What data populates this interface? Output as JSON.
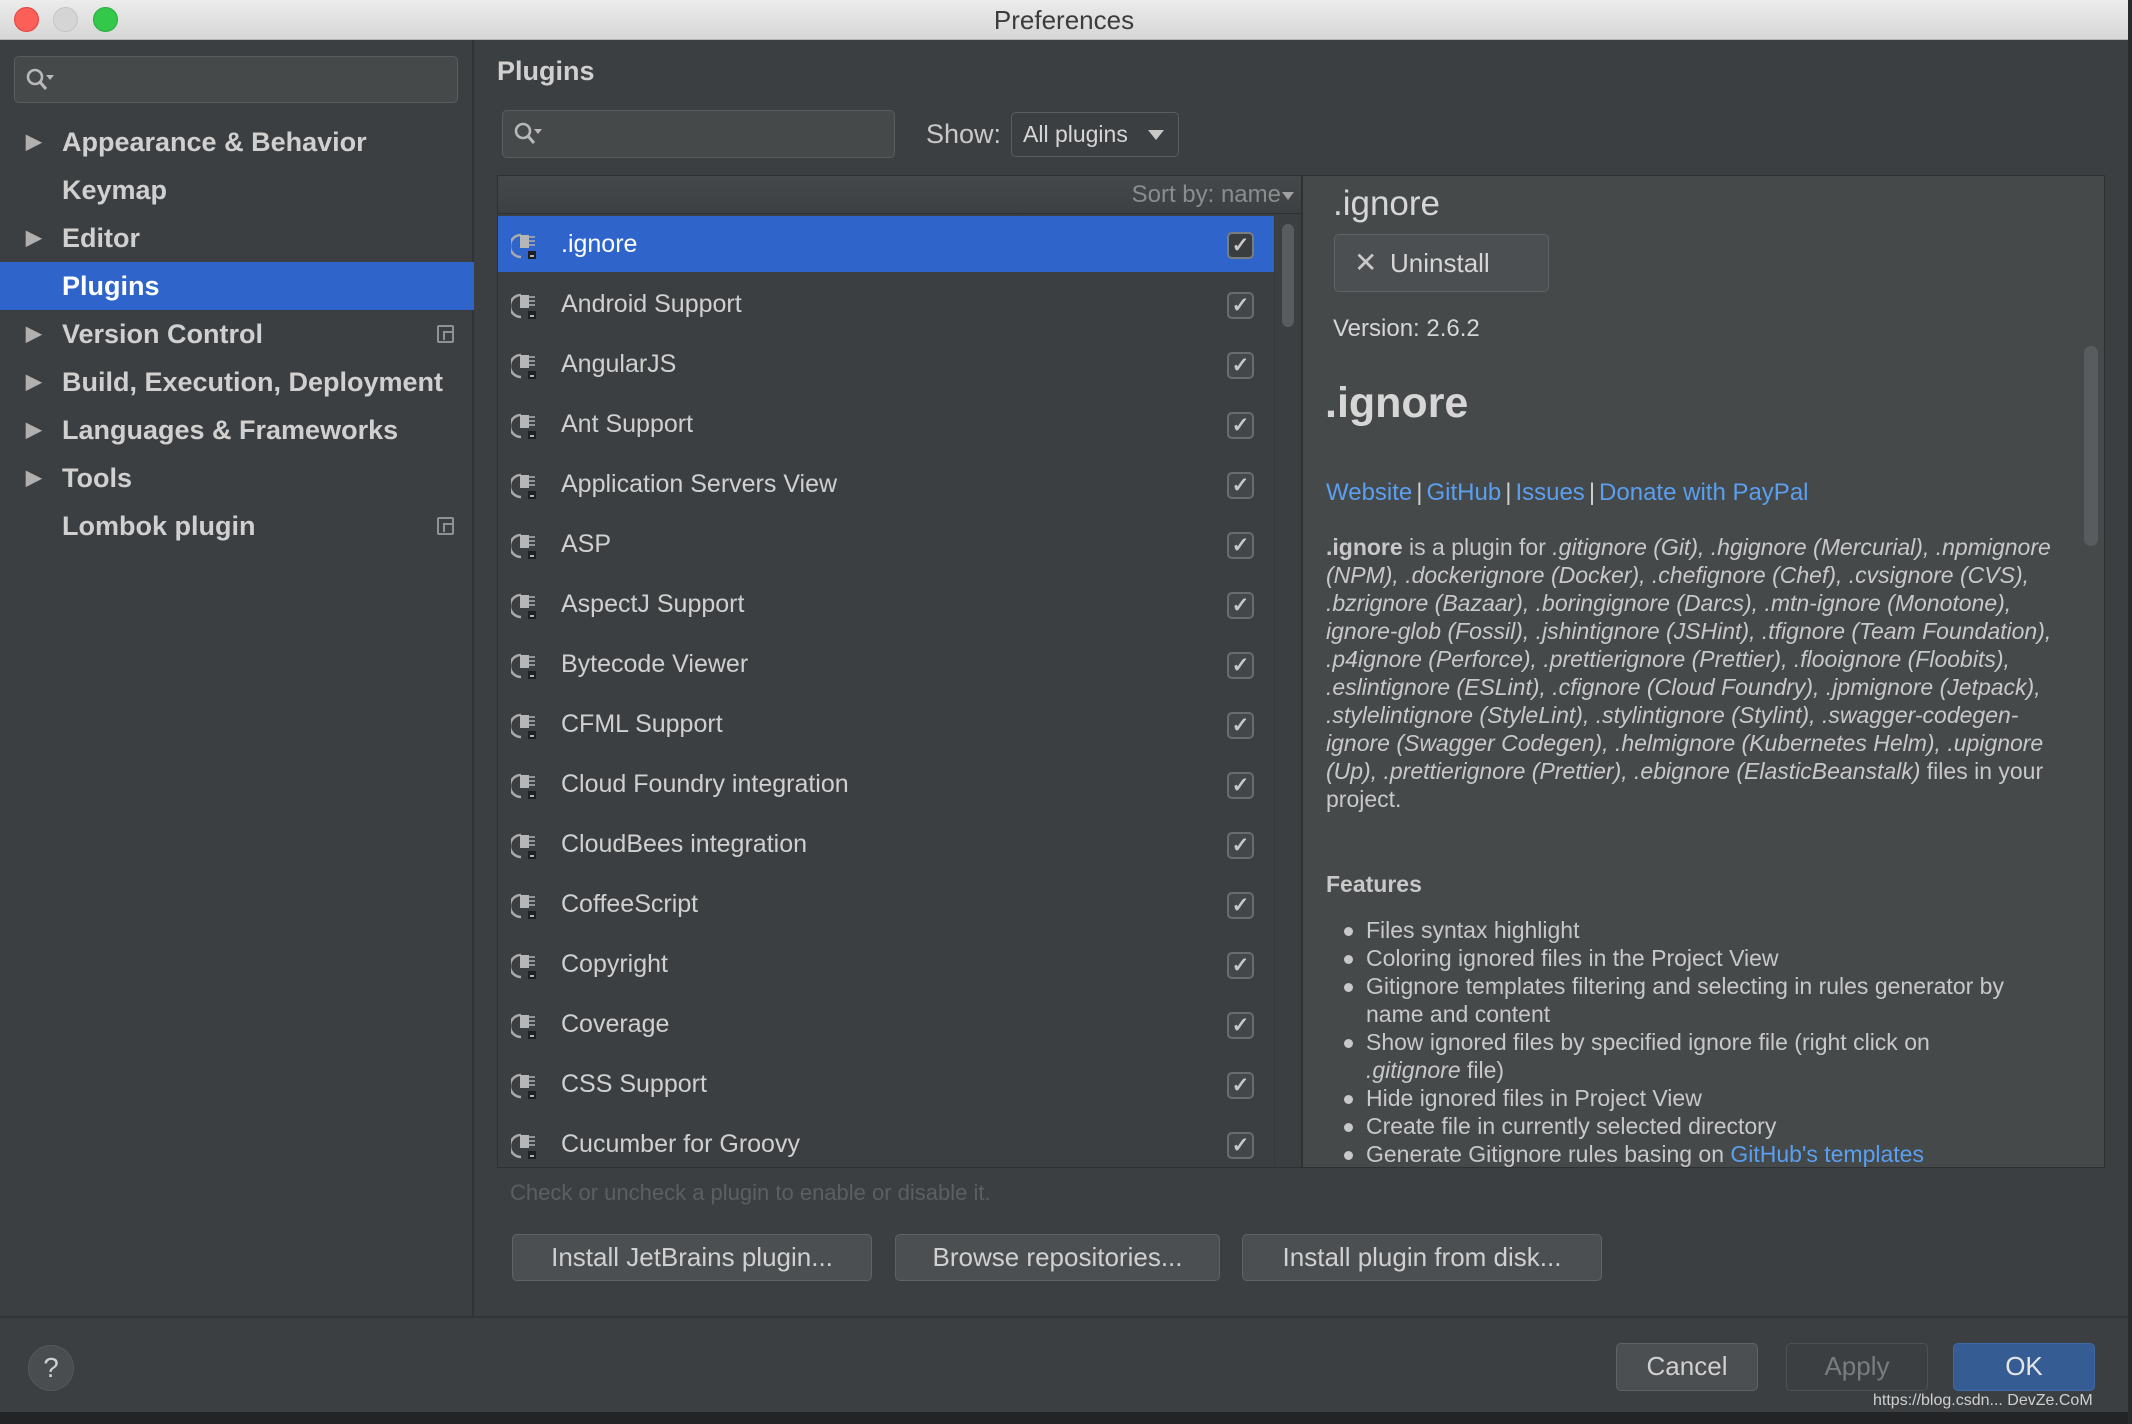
{
  "window": {
    "title": "Preferences"
  },
  "sidebar": {
    "search_placeholder": "",
    "items": [
      {
        "label": "Appearance & Behavior",
        "expandable": true,
        "selected": false,
        "project_icon": false
      },
      {
        "label": "Keymap",
        "expandable": false,
        "selected": false,
        "project_icon": false
      },
      {
        "label": "Editor",
        "expandable": true,
        "selected": false,
        "project_icon": false
      },
      {
        "label": "Plugins",
        "expandable": false,
        "selected": true,
        "project_icon": false
      },
      {
        "label": "Version Control",
        "expandable": true,
        "selected": false,
        "project_icon": true
      },
      {
        "label": "Build, Execution, Deployment",
        "expandable": true,
        "selected": false,
        "project_icon": false
      },
      {
        "label": "Languages & Frameworks",
        "expandable": true,
        "selected": false,
        "project_icon": false
      },
      {
        "label": "Tools",
        "expandable": true,
        "selected": false,
        "project_icon": false
      },
      {
        "label": "Lombok plugin",
        "expandable": false,
        "selected": false,
        "project_icon": true
      }
    ],
    "expand_glyph": "▶"
  },
  "main": {
    "title": "Plugins",
    "search_value": "",
    "show_label": "Show:",
    "show_selected": "All plugins",
    "sort_label": "Sort by: name",
    "plugins": [
      {
        "name": ".ignore",
        "enabled": true,
        "selected": true
      },
      {
        "name": "Android Support",
        "enabled": true,
        "selected": false
      },
      {
        "name": "AngularJS",
        "enabled": true,
        "selected": false
      },
      {
        "name": "Ant Support",
        "enabled": true,
        "selected": false
      },
      {
        "name": "Application Servers View",
        "enabled": true,
        "selected": false
      },
      {
        "name": "ASP",
        "enabled": true,
        "selected": false
      },
      {
        "name": "AspectJ Support",
        "enabled": true,
        "selected": false
      },
      {
        "name": "Bytecode Viewer",
        "enabled": true,
        "selected": false
      },
      {
        "name": "CFML Support",
        "enabled": true,
        "selected": false
      },
      {
        "name": "Cloud Foundry integration",
        "enabled": true,
        "selected": false
      },
      {
        "name": "CloudBees integration",
        "enabled": true,
        "selected": false
      },
      {
        "name": "CoffeeScript",
        "enabled": true,
        "selected": false
      },
      {
        "name": "Copyright",
        "enabled": true,
        "selected": false
      },
      {
        "name": "Coverage",
        "enabled": true,
        "selected": false
      },
      {
        "name": "CSS Support",
        "enabled": true,
        "selected": false
      },
      {
        "name": "Cucumber for Groovy",
        "enabled": true,
        "selected": false
      }
    ],
    "checkmark_glyph": "✓",
    "hint": "Check or uncheck a plugin to enable or disable it.",
    "buttons": {
      "install_jetbrains": "Install JetBrains plugin...",
      "browse": "Browse repositories...",
      "install_disk": "Install plugin from disk..."
    }
  },
  "details": {
    "name": ".ignore",
    "uninstall_label": "Uninstall",
    "uninstall_glyph": "✕",
    "version": "Version: 2.6.2",
    "heading": ".ignore",
    "links": [
      "Website",
      "GitHub",
      "Issues",
      "Donate with PayPal"
    ],
    "link_separator": "|",
    "description": {
      "lead_bold": ".ignore",
      "lead_text": " is a plugin for ",
      "body_italic": ".gitignore (Git), .hgignore (Mercurial), .npmignore (NPM), .dockerignore (Docker), .chefignore (Chef), .cvsignore (CVS), .bzrignore (Bazaar), .boringignore (Darcs), .mtn-ignore (Monotone), ignore-glob (Fossil), .jshintignore (JSHint), .tfignore (Team Foundation), .p4ignore (Perforce), .prettierignore (Prettier), .flooignore (Floobits), .eslintignore (ESLint), .cfignore (Cloud Foundry), .jpmignore (Jetpack), .stylelintignore (StyleLint), .stylintignore (Stylint), .swagger-codegen-ignore (Swagger Codegen), .helmignore (Kubernetes Helm), .upignore (Up), .prettierignore (Prettier), .ebignore (ElasticBeanstalk)",
      "tail_text": " files in your project."
    },
    "features_heading": "Features",
    "features": [
      {
        "text": "Files syntax highlight"
      },
      {
        "text": "Coloring ignored files in the Project View"
      },
      {
        "text": "Gitignore templates filtering and selecting in rules generator by name and content"
      },
      {
        "pre_italic": ".gitignore",
        "text": "Show ignored files by specified ignore file (right click on ",
        "post": " file)"
      },
      {
        "text": "Hide ignored files in Project View"
      },
      {
        "text": "Create file in currently selected directory"
      },
      {
        "text": "Generate Gitignore rules basing on ",
        "link": "GitHub's templates"
      }
    ]
  },
  "footer": {
    "help_glyph": "?",
    "cancel": "Cancel",
    "apply": "Apply",
    "ok": "OK",
    "watermark": "https://blog.csdn... DevZe.CoM"
  },
  "colors": {
    "accent": "#2f65ca",
    "link": "#5a9ff0",
    "background": "#3c3f41",
    "panel": "#45494a"
  }
}
